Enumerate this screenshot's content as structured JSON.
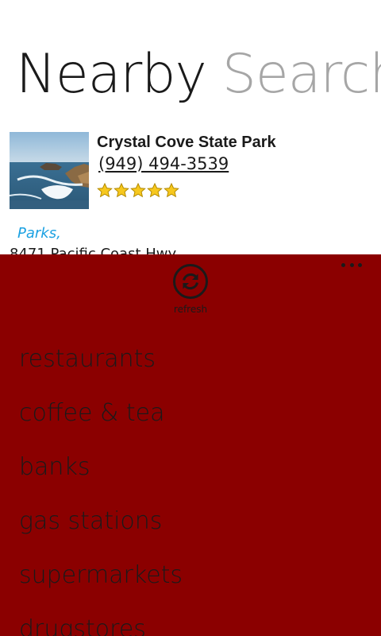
{
  "pivot": {
    "active": "Nearby",
    "inactive": "Search"
  },
  "result": {
    "name": "Crystal Cove State Park",
    "phone": "(949) 494-3539",
    "rating": 5,
    "category": "Parks,",
    "address": "8471 Pacific Coast Hwy"
  },
  "appbar": {
    "background": "#8b0000",
    "refresh_label": "refresh",
    "menu_items": [
      "restaurants",
      "coffee & tea",
      "banks",
      "gas stations",
      "supermarkets",
      "drugstores"
    ]
  },
  "icons": {
    "thumbnail": "beach-photo",
    "star": "star-icon",
    "refresh": "refresh-icon",
    "more": "ellipsis-icon"
  },
  "colors": {
    "accent_link": "#1ba1e2",
    "star_fill": "#f7c81e"
  }
}
